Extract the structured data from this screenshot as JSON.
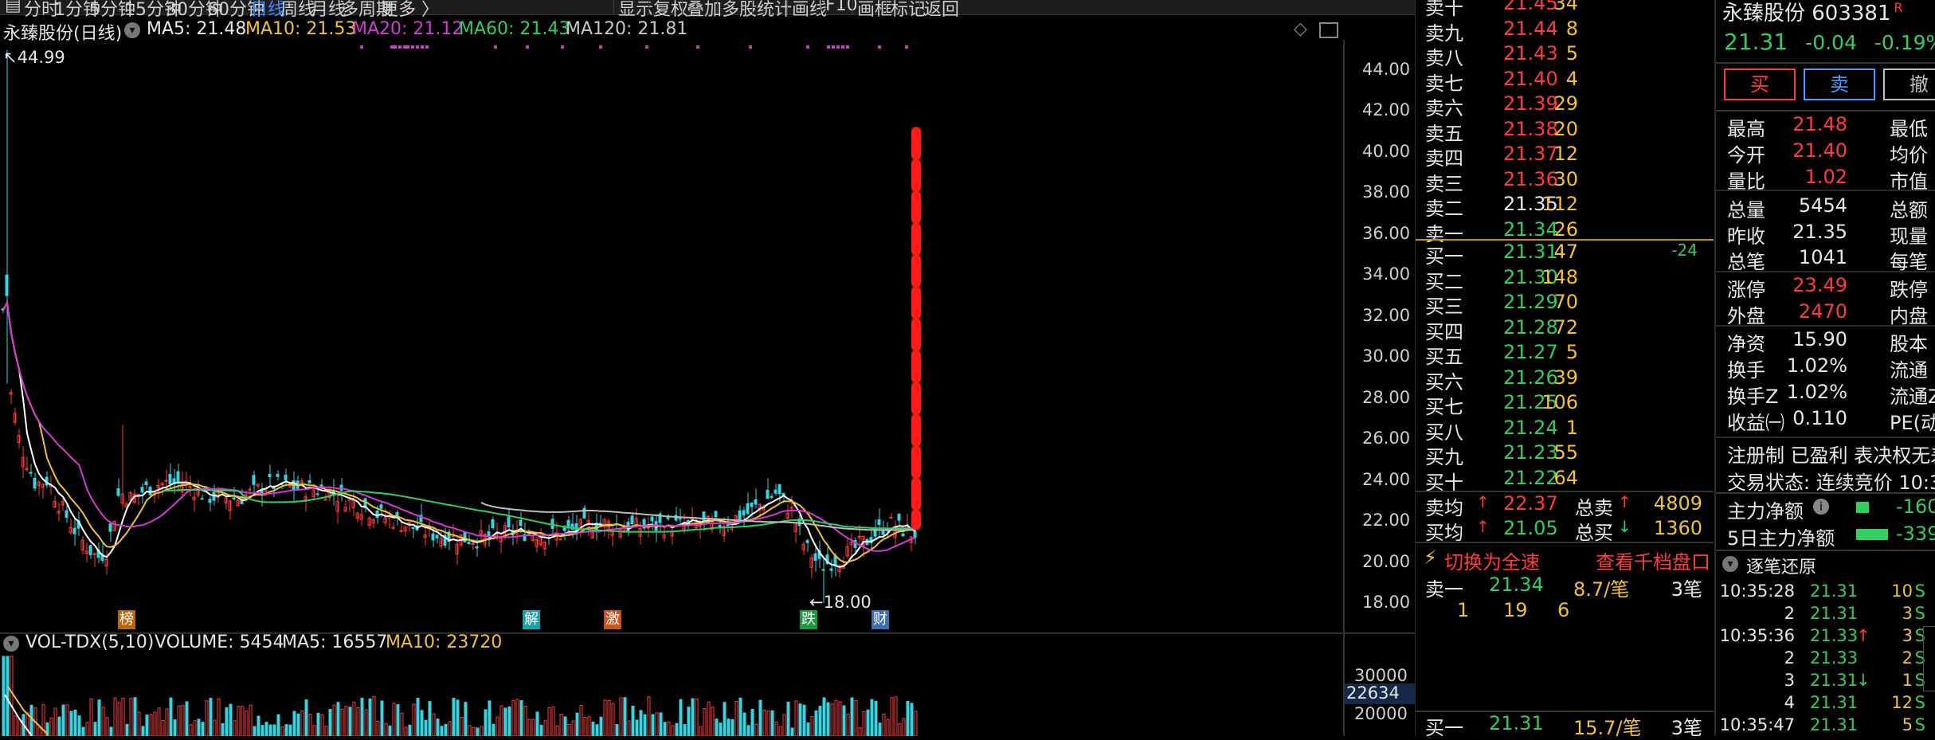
{
  "toolbar": {
    "left_items": [
      "分时",
      "1分钟",
      "5分钟",
      "15分钟",
      "30分钟",
      "60分钟",
      "日线",
      "周线",
      "月线",
      "多周期",
      "更多"
    ],
    "active": "日线",
    "right_items": [
      "显示",
      "复权",
      "叠加",
      "多股",
      "统计",
      "画线",
      "F10",
      "画框",
      "标记",
      "返回"
    ]
  },
  "chart_title": {
    "name": "永臻股份(日线)",
    "ma": [
      {
        "label": "MA5: 21.48",
        "color": "#e8e8e8"
      },
      {
        "label": "MA10: 21.53",
        "color": "#f1c232"
      },
      {
        "label": "MA20: 21.12",
        "color": "#d23bd2"
      },
      {
        "label": "MA60: 21.43",
        "color": "#2fcf62"
      },
      {
        "label": "MA120: 21.81",
        "color": "#c8c8c8"
      }
    ]
  },
  "price_axis": [
    "44.00",
    "42.00",
    "40.00",
    "38.00",
    "36.00",
    "34.00",
    "32.00",
    "30.00",
    "28.00",
    "26.00",
    "24.00",
    "22.00",
    "20.00",
    "18.00"
  ],
  "annotations": {
    "high": "44.99",
    "low": "18.00"
  },
  "event_tags": [
    {
      "label": "榜",
      "color": "#b8660c"
    },
    {
      "label": "解",
      "color": "#1aa0a8"
    },
    {
      "label": "激",
      "color": "#c8551e"
    },
    {
      "label": "跌",
      "color": "#1b9a3a"
    },
    {
      "label": "财",
      "color": "#3d6fb0"
    }
  ],
  "volume_legend": {
    "name": "VOL-TDX(5,10)",
    "items": [
      {
        "label": "VOLUME: 5454",
        "color": "#e6e6e6"
      },
      {
        "label": "MA5: 16557",
        "color": "#e6e6e6"
      },
      {
        "label": "MA10: 23720",
        "color": "#f1c232"
      }
    ]
  },
  "volume_axis": [
    "30000",
    "20000"
  ],
  "volume_cursor": "22634",
  "order_book": {
    "asks": [
      {
        "label": "卖十",
        "price": "21.45",
        "vol": "34"
      },
      {
        "label": "卖九",
        "price": "21.44",
        "vol": "8"
      },
      {
        "label": "卖八",
        "price": "21.43",
        "vol": "5"
      },
      {
        "label": "卖七",
        "price": "21.40",
        "vol": "4"
      },
      {
        "label": "卖六",
        "price": "21.39",
        "vol": "29"
      },
      {
        "label": "卖五",
        "price": "21.38",
        "vol": "20"
      },
      {
        "label": "卖四",
        "price": "21.37",
        "vol": "12"
      },
      {
        "label": "卖三",
        "price": "21.36",
        "vol": "30"
      },
      {
        "label": "卖二",
        "price": "21.35",
        "vol": "112"
      },
      {
        "label": "卖一",
        "price": "21.34",
        "vol": "26"
      }
    ],
    "bids": [
      {
        "label": "买一",
        "price": "21.31",
        "vol": "47",
        "chg": "-24"
      },
      {
        "label": "买二",
        "price": "21.30",
        "vol": "148",
        "chg": ""
      },
      {
        "label": "买三",
        "price": "21.29",
        "vol": "70",
        "chg": ""
      },
      {
        "label": "买四",
        "price": "21.28",
        "vol": "72",
        "chg": ""
      },
      {
        "label": "买五",
        "price": "21.27",
        "vol": "5",
        "chg": ""
      },
      {
        "label": "买六",
        "price": "21.26",
        "vol": "39",
        "chg": ""
      },
      {
        "label": "买七",
        "price": "21.25",
        "vol": "106",
        "chg": ""
      },
      {
        "label": "买八",
        "price": "21.24",
        "vol": "1",
        "chg": ""
      },
      {
        "label": "买九",
        "price": "21.23",
        "vol": "55",
        "chg": ""
      },
      {
        "label": "买十",
        "price": "21.22",
        "vol": "64",
        "chg": ""
      }
    ],
    "avg_sell": {
      "label": "卖均",
      "price": "22.37",
      "total_label": "总卖",
      "total": "4809"
    },
    "avg_buy": {
      "label": "买均",
      "price": "21.05",
      "total_label": "总买",
      "total": "1360"
    },
    "switch_label": "切换为全速",
    "view_label": "查看千档盘口",
    "queue1": {
      "label": "卖一",
      "price": "21.34",
      "per": "8.7/笔",
      "count": "3笔",
      "orders": [
        "1",
        "19",
        "6"
      ]
    },
    "queue2": {
      "label": "买一",
      "price": "21.31",
      "per": "15.7/笔",
      "count": "3笔"
    }
  },
  "quote": {
    "name": "永臻股份",
    "code": "603381",
    "tag": "R",
    "price": "21.31",
    "change": "-0.04",
    "pct": "-0.19%",
    "buy_btn": "买",
    "sell_btn": "卖",
    "cancel_btn": "撤",
    "stats": [
      {
        "l1": "最高",
        "v1": "21.48",
        "c1": "red",
        "l2": "最低"
      },
      {
        "l1": "今开",
        "v1": "21.40",
        "c1": "red",
        "l2": "均价"
      },
      {
        "l1": "量比",
        "v1": "1.02",
        "c1": "red",
        "l2": "市值"
      },
      {
        "l1": "总量",
        "v1": "5454",
        "c1": "white",
        "l2": "总额"
      },
      {
        "l1": "昨收",
        "v1": "21.35",
        "c1": "white",
        "l2": "现量"
      },
      {
        "l1": "总笔",
        "v1": "1041",
        "c1": "white",
        "l2": "每笔"
      },
      {
        "l1": "涨停",
        "v1": "23.49",
        "c1": "red",
        "l2": "跌停"
      },
      {
        "l1": "外盘",
        "v1": "2470",
        "c1": "red",
        "l2": "内盘"
      },
      {
        "l1": "净资",
        "v1": "15.90",
        "c1": "white",
        "l2": "股本"
      },
      {
        "l1": "换手",
        "v1": "1.02%",
        "c1": "white",
        "l2": "流通"
      },
      {
        "l1": "换手Z",
        "v1": "1.02%",
        "c1": "white",
        "l2": "流通Z"
      },
      {
        "l1": "收益㈠",
        "v1": "0.110",
        "c1": "white",
        "l2": "PE(动"
      }
    ],
    "tags_line": "注册制 已盈利 表决权无差",
    "status_line": "交易状态: 连续竞价 10:3",
    "main_net": {
      "label": "主力净额",
      "value": "-160"
    },
    "main_net5": {
      "label": "5日主力净额",
      "value": "-339"
    },
    "ticks_title": "逐笔还原",
    "ticks": [
      {
        "time": "10:35:28",
        "price": "21.31",
        "vol": "10",
        "dir": "S",
        "pc": "green",
        "arrow": ""
      },
      {
        "time": "2",
        "price": "21.31",
        "vol": "3",
        "dir": "S",
        "pc": "green",
        "arrow": ""
      },
      {
        "time": "10:35:36",
        "price": "21.33",
        "vol": "3",
        "dir": "S",
        "pc": "green",
        "arrow": "up"
      },
      {
        "time": "2",
        "price": "21.33",
        "vol": "2",
        "dir": "S",
        "pc": "green",
        "arrow": ""
      },
      {
        "time": "3",
        "price": "21.31",
        "vol": "1",
        "dir": "S",
        "pc": "green",
        "arrow": "down"
      },
      {
        "time": "4",
        "price": "21.31",
        "vol": "12",
        "dir": "S",
        "pc": "green",
        "arrow": ""
      },
      {
        "time": "10:35:47",
        "price": "21.31",
        "vol": "5",
        "dir": "S",
        "pc": "green",
        "arrow": ""
      }
    ]
  }
}
